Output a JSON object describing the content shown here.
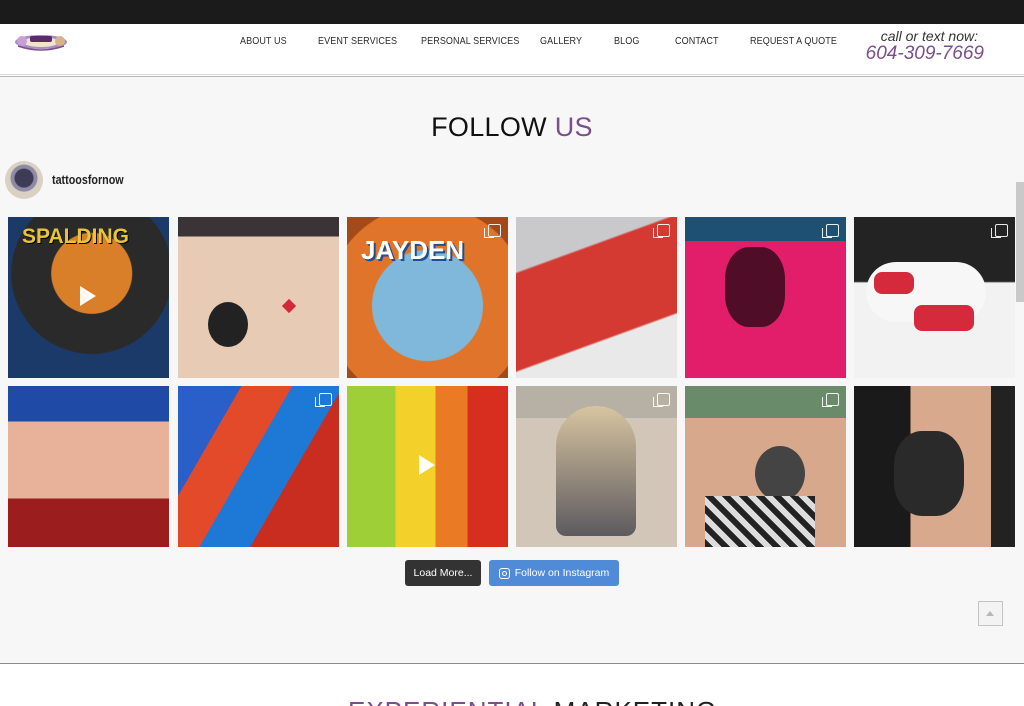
{
  "header": {
    "nav": [
      "ABOUT US",
      "EVENT SERVICES",
      "PERSONAL SERVICES",
      "GALLERY",
      "BLOG",
      "CONTACT",
      "REQUEST A QUOTE"
    ],
    "call_label": "call or text now:",
    "phone": "604-309-7669"
  },
  "section": {
    "title_part1": "FOLLOW",
    "title_part2": "US",
    "handle": "tattoosfornow"
  },
  "feed": {
    "captions": [
      "SPALDING",
      "",
      "JAYDEN",
      "",
      "",
      "",
      "",
      "",
      "",
      "",
      "",
      ""
    ]
  },
  "buttons": {
    "load_more": "Load More...",
    "follow_instagram": "Follow on Instagram"
  },
  "next_section": {
    "title_part1": "EXPERIENTIAL",
    "title_part2": " MARKETING"
  },
  "colors": {
    "accent": "#7a4f8a",
    "instagram_button": "#4f8bd6",
    "dark_button": "#333333",
    "topbar": "#1b1b1b"
  },
  "icons": {
    "video_tiles": [
      0,
      8
    ],
    "multi_tiles": [
      2,
      3,
      4,
      5,
      7,
      9
    ]
  }
}
